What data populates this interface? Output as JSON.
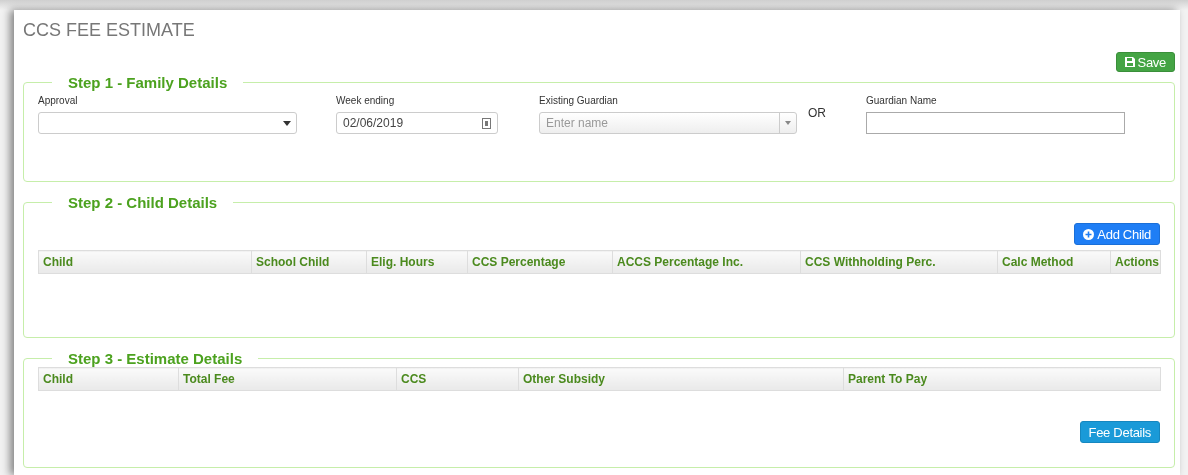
{
  "title": "CCS FEE ESTIMATE",
  "save_button": "Save",
  "step1": {
    "legend": "Step 1 - Family Details",
    "fields": [
      {
        "kind": "select",
        "label": "Approval"
      },
      {
        "kind": "date",
        "label": "Week ending",
        "value": "02/06/2019"
      },
      {
        "kind": "combo",
        "label": "Existing Guardian",
        "placeholder": "Enter name"
      },
      {
        "kind": "separator",
        "text": "OR"
      },
      {
        "kind": "text",
        "label": "Guardian Name"
      }
    ]
  },
  "step2": {
    "legend": "Step 2 - Child Details",
    "button": "Add Child",
    "columns": [
      "Child",
      "School Child",
      "Elig. Hours",
      "CCS Percentage",
      "ACCS Percentage Inc.",
      "CCS Withholding Perc.",
      "Calc Method",
      "Actions"
    ]
  },
  "step3": {
    "legend": "Step 3 - Estimate Details",
    "button": "Fee Details",
    "columns": [
      "Child",
      "Total Fee",
      "CCS",
      "Other Subsidy",
      "Parent To Pay"
    ]
  }
}
